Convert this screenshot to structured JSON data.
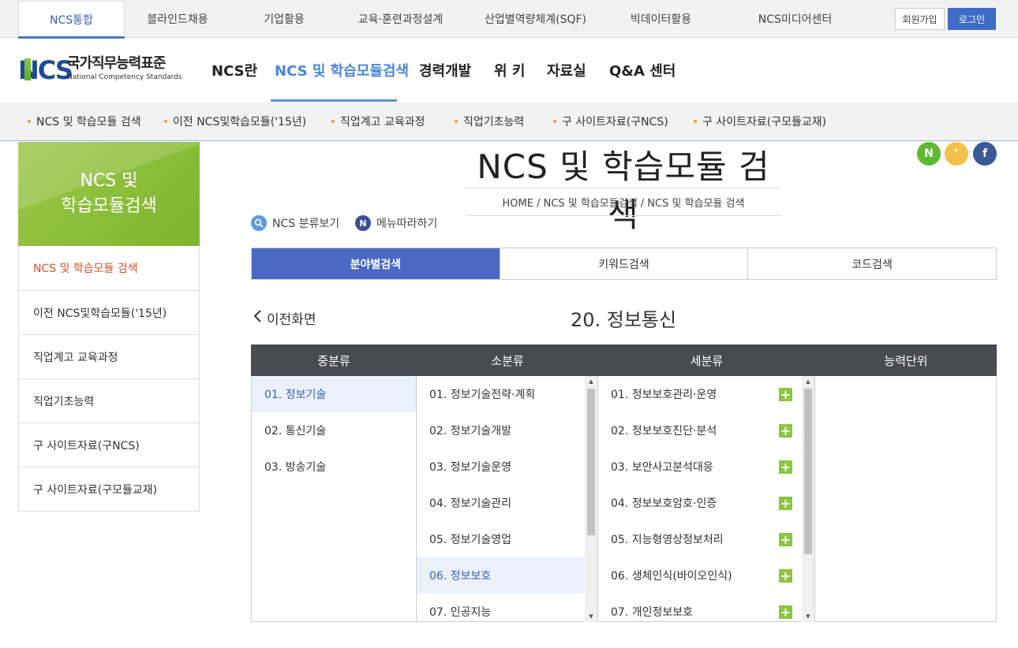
{
  "topbar": {
    "tabs": [
      "NCS통합",
      "블라인드채용",
      "기업활용",
      "교육·훈련과정설계",
      "산업별역량체계(SQF)",
      "빅데이터활용",
      "NCS미디어센터"
    ],
    "join_label": "회원가입",
    "login_label": "로그인"
  },
  "logo": {
    "mark": "NCS",
    "kor": "국가직무능력표준",
    "eng": "National Competency Standards"
  },
  "gnb": [
    "NCS란",
    "NCS 및 학습모듈검색",
    "경력개발",
    "위 키",
    "자료실",
    "Q&A 센터"
  ],
  "subnav": [
    "NCS 및 학습모듈 검색",
    "이전 NCS및학습모듈('15년)",
    "직업계고 교육과정",
    "직업기초능력",
    "구 사이트자료(구NCS)",
    "구 사이트자료(구모듈교재)"
  ],
  "lnb": {
    "title_line1": "NCS 및",
    "title_line2": "학습모듈검색",
    "items": [
      "NCS 및 학습모듈 검색",
      "이전 NCS및학습모듈('15년)",
      "직업계고 교육과정",
      "직업기초능력",
      "구 사이트자료(구NCS)",
      "구 사이트자료(구모듈교재)"
    ]
  },
  "page": {
    "title": "NCS 및 학습모듈 검색",
    "breadcrumb": "HOME / NCS 및 학습모듈검색 / NCS 및 학습모듈 검색",
    "social": [
      "N",
      "❜",
      "f"
    ],
    "util_classify": "NCS 분류보기",
    "util_follow": "메뉴따라하기",
    "util_follow_icon": "N"
  },
  "tabs": [
    "분야별검색",
    "키워드검색",
    "코드검색"
  ],
  "back_label": "이전화면",
  "section_title": "20. 정보통신",
  "table": {
    "headers": [
      "중분류",
      "소분류",
      "세분류",
      "능력단위"
    ],
    "mid": [
      "01. 정보기술",
      "02. 통신기술",
      "03. 방송기술"
    ],
    "small": [
      "01. 정보기술전략·계획",
      "02. 정보기술개발",
      "03. 정보기술운영",
      "04. 정보기술관리",
      "05. 정보기술영업",
      "06. 정보보호",
      "07. 인공지능"
    ],
    "detail": [
      "01. 정보보호관리·운영",
      "02. 정보보호진단·분석",
      "03. 보안사고분석대응",
      "04. 정보보호암호·인증",
      "05. 지능형영상정보처리",
      "06. 생체인식(바이오인식)",
      "07. 개인정보보호"
    ],
    "plus_symbol": "+"
  },
  "colors": {
    "accent_blue": "#4a68c4",
    "green": "#8cc63f",
    "active_red": "#d9542b",
    "header_dark": "#4a4b50"
  }
}
